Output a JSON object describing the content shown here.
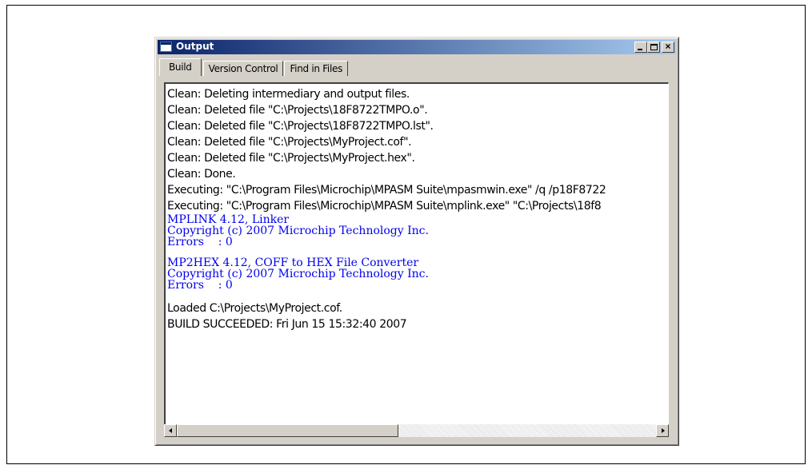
{
  "window": {
    "title": "Output",
    "buttons": {
      "minimize": "_",
      "maximize": "□",
      "close": "×"
    }
  },
  "tabs": [
    {
      "label": "Build",
      "active": true
    },
    {
      "label": "Version Control",
      "active": false
    },
    {
      "label": "Find in Files",
      "active": false
    }
  ],
  "output": {
    "clean_lines": [
      "Clean: Deleting intermediary and output files.",
      "Clean: Deleted file \"C:\\Projects\\18F8722TMPO.o\".",
      "Clean: Deleted file \"C:\\Projects\\18F8722TMPO.lst\".",
      "Clean: Deleted file \"C:\\Projects\\MyProject.cof\".",
      "Clean: Deleted file \"C:\\Projects\\MyProject.hex\".",
      "Clean: Done.",
      "Executing: \"C:\\Program Files\\Microchip\\MPASM Suite\\mpasmwin.exe\" /q /p18F8722",
      "Executing: \"C:\\Program Files\\Microchip\\MPASM Suite\\mplink.exe\" \"C:\\Projects\\18f8"
    ],
    "mplink_lines": [
      "MPLINK 4.12, Linker",
      "Copyright (c) 2007 Microchip Technology Inc.",
      "Errors    : 0"
    ],
    "mp2hex_lines": [
      "MP2HEX 4.12, COFF to HEX File Converter",
      "Copyright (c) 2007 Microchip Technology Inc.",
      "Errors    : 0"
    ],
    "result_lines": [
      "Loaded C:\\Projects\\MyProject.cof.",
      "BUILD SUCCEEDED: Fri Jun 15 15:32:40 2007"
    ]
  },
  "colors": {
    "tool_output_text": "#0000ee",
    "title_bar": "#0a246a",
    "window_face": "#d4d0c8"
  },
  "scrollbar": {
    "horizontal_position": 0.0
  }
}
